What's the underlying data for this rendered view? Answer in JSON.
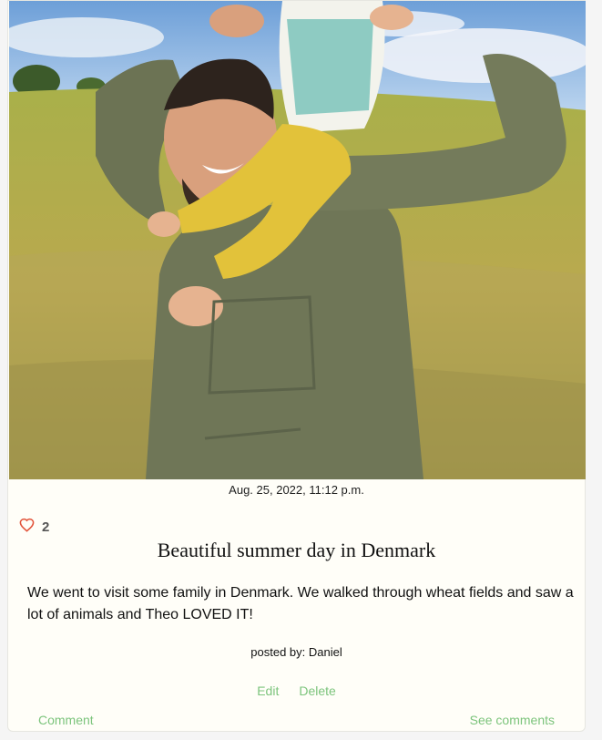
{
  "post": {
    "timestamp": "Aug. 25, 2022, 11:12 p.m.",
    "like_count": "2",
    "title": "Beautiful summer day in Denmark",
    "body": "We went to visit some family in Denmark. We walked through wheat fields and saw a lot of animals and Theo LOVED IT!",
    "posted_by": "posted by: Daniel"
  },
  "actions": {
    "edit_label": "Edit",
    "delete_label": "Delete",
    "comment_label": "Comment",
    "see_comments_label": "See comments"
  },
  "icons": {
    "like": "heart-outline-icon"
  },
  "colors": {
    "link": "#7cc47c",
    "heart": "#e2533a",
    "card_bg": "#fffef8"
  }
}
